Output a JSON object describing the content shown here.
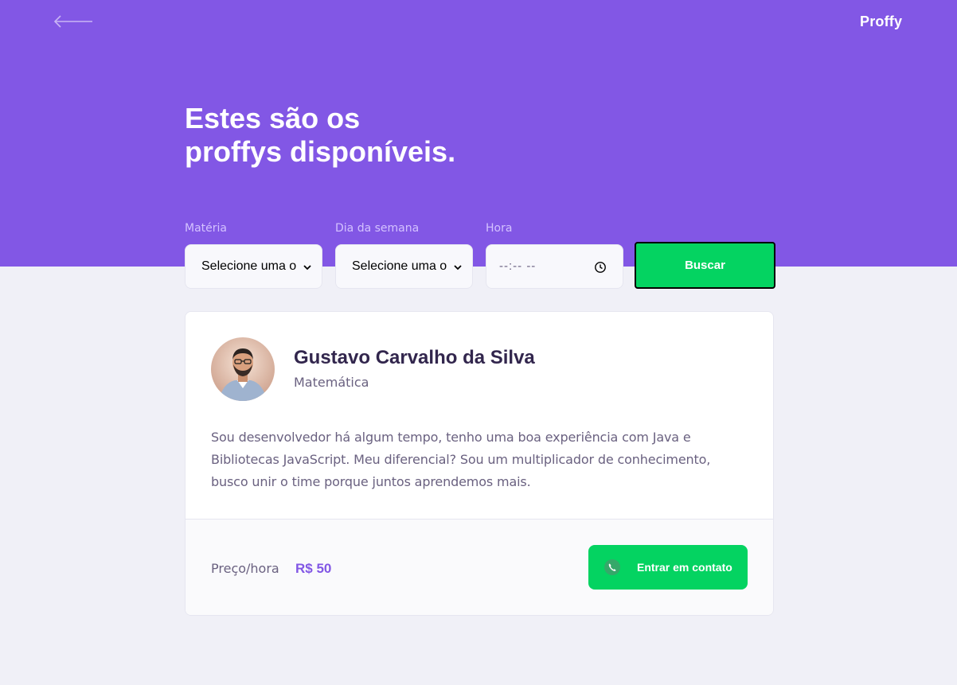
{
  "header": {
    "logo": "Proffy",
    "title_line1": "Estes são os",
    "title_line2": "proffys disponíveis."
  },
  "filters": {
    "subject": {
      "label": "Matéria",
      "value": "Selecione uma o"
    },
    "week_day": {
      "label": "Dia da semana",
      "value": "Selecione uma o"
    },
    "time": {
      "label": "Hora",
      "value": "--:-- --"
    },
    "search_button": "Buscar"
  },
  "teacher": {
    "name": "Gustavo Carvalho da Silva",
    "subject": "Matemática",
    "bio": "Sou desenvolvedor há algum tempo, tenho uma boa experiência com Java e Bibliotecas JavaScript. Meu diferencial? Sou um multiplicador de conhecimento, busco unir o time porque juntos aprendemos mais.",
    "price_label": "Preço/hora",
    "price_value": "R$ 50",
    "contact_button": "Entrar em contato"
  },
  "colors": {
    "primary": "#8257e5",
    "secondary": "#04d361",
    "background": "#f0f0f7",
    "title_text": "#32264d",
    "body_text": "#6a6180"
  },
  "icons": {
    "back": "arrow-left-icon",
    "contact": "whatsapp-icon",
    "time": "clock-icon",
    "select": "chevron-down-icon"
  }
}
